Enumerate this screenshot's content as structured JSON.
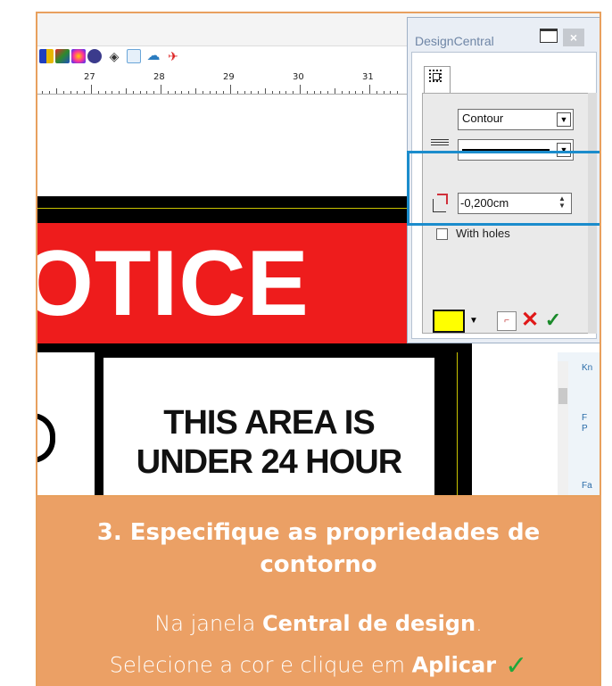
{
  "ruler": {
    "labels": [
      "27",
      "28",
      "29",
      "30",
      "31"
    ]
  },
  "sign": {
    "header_text": "OTICE",
    "body_lines": [
      "THIS AREA IS",
      "UNDER 24 HOUR"
    ]
  },
  "right_panel": {
    "fragments": [
      "Kn",
      "F",
      "P",
      "Fa"
    ]
  },
  "design_central": {
    "title": "DesignCentral",
    "close_label": "×",
    "contour_type": "Contour",
    "line_style": "",
    "offset_value": "-0,200cm",
    "with_holes_label": "With holes",
    "with_holes_checked": false,
    "fill_color": "#ffff00",
    "cancel_symbol": "✕",
    "apply_symbol": "✓"
  },
  "caption": {
    "title": "3. Especifique as propriedades de contorno",
    "line1_prefix": "Na janela ",
    "line1_bold": "Central de design",
    "line1_suffix": ".",
    "line2_prefix": "Selecione a cor e clique em ",
    "line2_bold": "Aplicar",
    "check_symbol": "✓"
  },
  "colors": {
    "frame_border": "#e8a05e",
    "caption_bg": "#eba065",
    "highlight": "#1b8ccc",
    "sign_red": "#ee1c1c",
    "apply_green": "#1a8a2a"
  }
}
